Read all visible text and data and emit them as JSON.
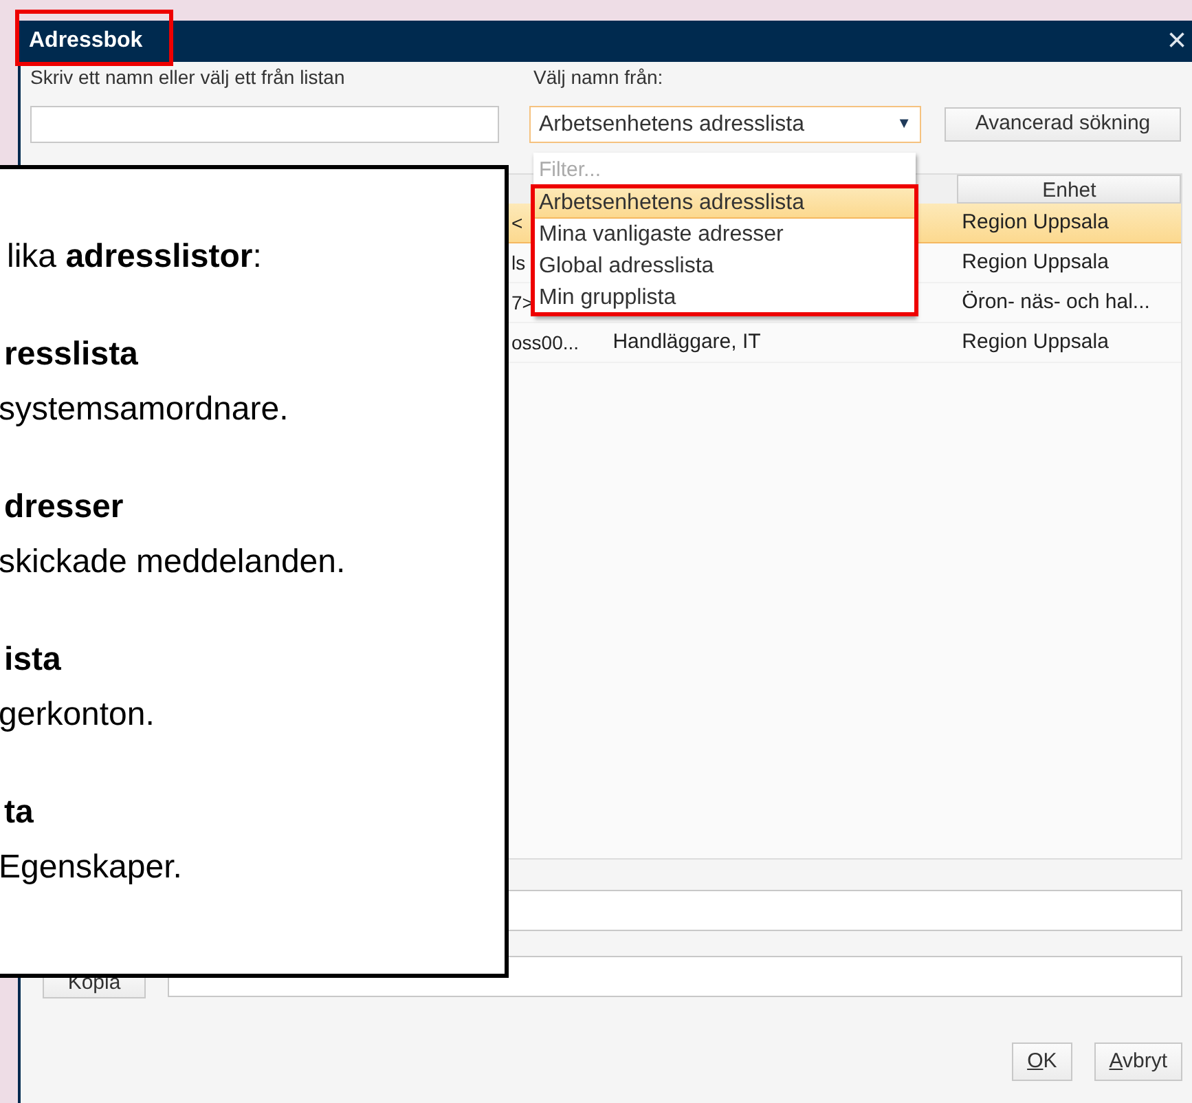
{
  "window": {
    "title": "Adressbok",
    "title_highlighted": true,
    "close": "×"
  },
  "name_search": {
    "label": "Skriv ett namn eller välj ett från listan"
  },
  "source": {
    "label": "Välj namn från:",
    "value": "Arbetsenhetens adresslista",
    "caret": "▼"
  },
  "advanced_button": "Avancerad sökning",
  "table": {
    "columns": [
      "Enhet"
    ],
    "rows": [
      {
        "column_1": "<",
        "column_2": "",
        "column_3": "Region Uppsala",
        "selected": true
      },
      {
        "column_1": "ls",
        "column_2": "",
        "column_3": "Region Uppsala",
        "selected": false
      },
      {
        "column_1": "7>",
        "column_2": "",
        "column_3": "Öron- näs- och hal...",
        "selected": false
      },
      {
        "column_1": "oss00...",
        "column_2": "Handläggare, IT",
        "column_3": "Region Uppsala",
        "selected": false
      }
    ]
  },
  "dropdown": {
    "filter_placeholder": "Filter...",
    "highlighted": true,
    "items": [
      {
        "label": "Arbetsenhetens adresslista",
        "selected": true
      },
      {
        "label": "Mina vanligaste adresser",
        "selected": false
      },
      {
        "label": "Global adresslista",
        "selected": false
      },
      {
        "label": "Min grupplista",
        "selected": false
      }
    ]
  },
  "copy_button": "Kopia",
  "buttons": [
    "OK",
    "Avbryt"
  ],
  "callout": {
    "intro": "lika **adresslistor**:",
    "entries": [
      {
        "heading": "resslista",
        "text": "systemsamordnare."
      },
      {
        "heading": "dresser",
        "text": "skickade meddelanden."
      },
      {
        "heading": "ista",
        "text": "gerkonton."
      },
      {
        "heading": "ta",
        "text": "Egenskaper."
      }
    ]
  }
}
